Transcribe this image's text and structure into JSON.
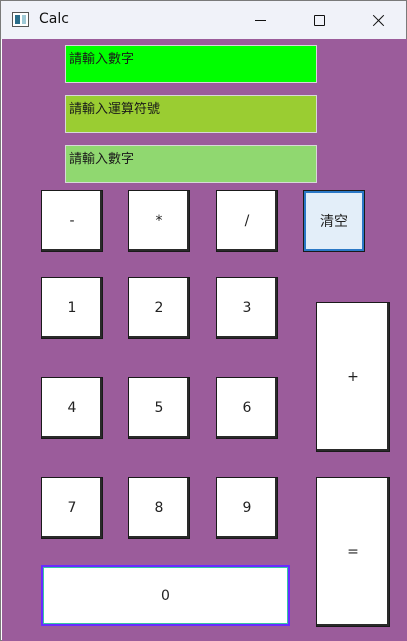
{
  "window": {
    "title": "Calc"
  },
  "inputs": {
    "first_number_placeholder": "請輸入數字",
    "operator_placeholder": "請輸入運算符號",
    "second_number_placeholder": "請輸入數字"
  },
  "buttons": {
    "minus": "-",
    "multiply": "*",
    "divide": "/",
    "clear": "清空",
    "one": "1",
    "two": "2",
    "three": "3",
    "four": "4",
    "five": "5",
    "six": "6",
    "seven": "7",
    "eight": "8",
    "nine": "9",
    "zero": "0",
    "plus": "+",
    "equals": "="
  },
  "colors": {
    "background": "#9b5c9b",
    "first_field": "#00ff00",
    "operator_field": "#9acd32",
    "second_field": "#90d870"
  }
}
